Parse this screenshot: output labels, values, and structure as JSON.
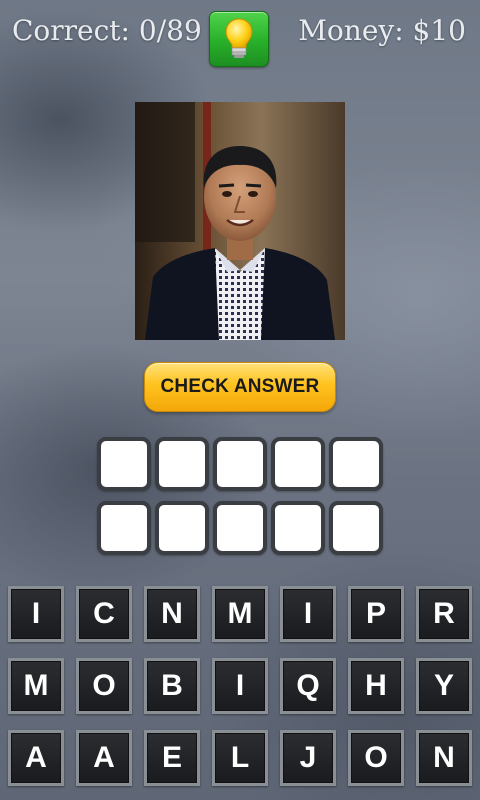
{
  "header": {
    "correct_text": "Correct: 0/89",
    "money_text": "Money: $10",
    "hint_icon": "lightbulb-icon"
  },
  "photo": {
    "subject": "portrait-photo"
  },
  "actions": {
    "check_answer_label": "CHECK ANSWER"
  },
  "answer_slots": {
    "row1": [
      "",
      "",
      "",
      "",
      ""
    ],
    "row2": [
      "",
      "",
      "",
      "",
      ""
    ]
  },
  "letters": {
    "row1": [
      "I",
      "C",
      "N",
      "M",
      "I",
      "P",
      "R"
    ],
    "row2": [
      "M",
      "O",
      "B",
      "I",
      "Q",
      "H",
      "Y"
    ],
    "row3": [
      "A",
      "A",
      "E",
      "L",
      "J",
      "O",
      "N"
    ]
  },
  "colors": {
    "hint_button": "#28b02a",
    "check_button": "#ffc21e",
    "tile_bg": "#1a1b1e"
  }
}
